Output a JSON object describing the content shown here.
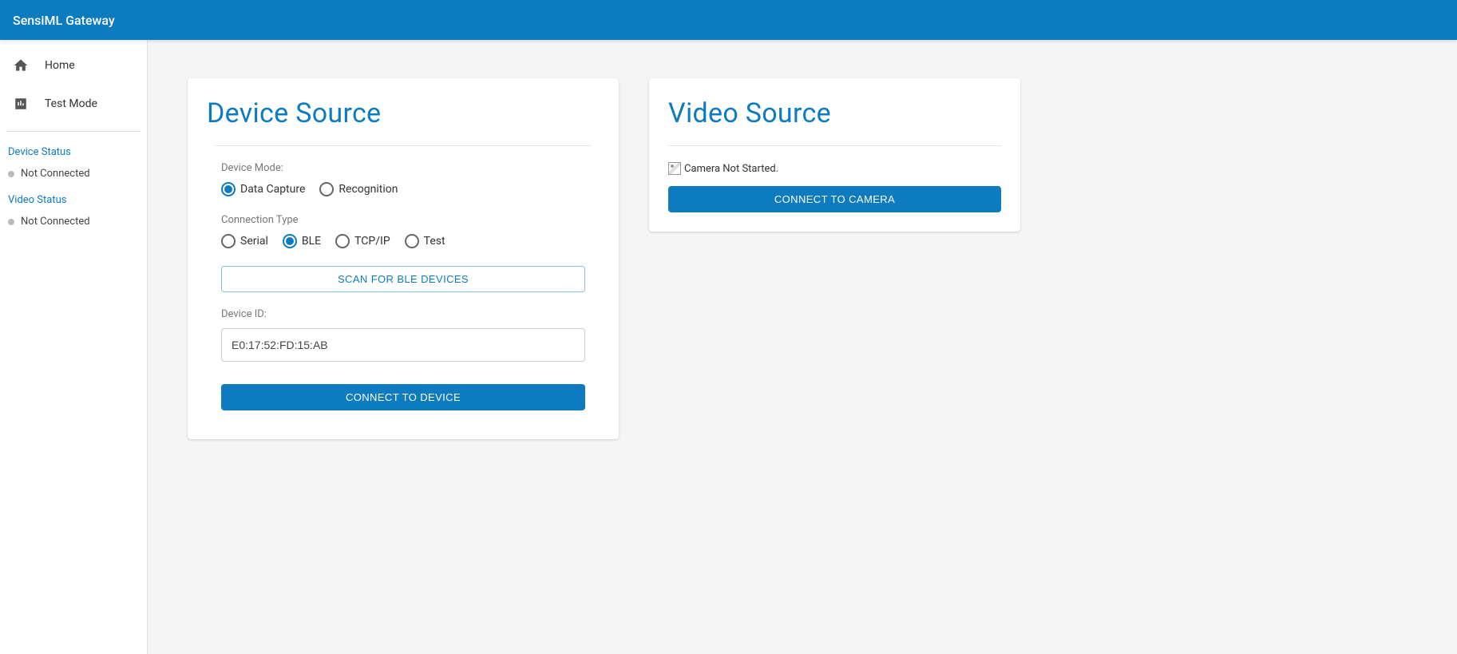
{
  "header": {
    "title": "SensiML Gateway"
  },
  "sidebar": {
    "nav": [
      {
        "label": "Home",
        "icon": "home"
      },
      {
        "label": "Test Mode",
        "icon": "bar-chart"
      }
    ],
    "device_status_title": "Device Status",
    "device_status_value": "Not Connected",
    "video_status_title": "Video Status",
    "video_status_value": "Not Connected"
  },
  "device_card": {
    "title": "Device Source",
    "mode_label": "Device Mode:",
    "mode_options": [
      "Data Capture",
      "Recognition"
    ],
    "mode_selected": "Data Capture",
    "conn_label": "Connection Type",
    "conn_options": [
      "Serial",
      "BLE",
      "TCP/IP",
      "Test"
    ],
    "conn_selected": "BLE",
    "scan_button": "SCAN FOR BLE DEVICES",
    "device_id_label": "Device ID:",
    "device_id_value": "E0:17:52:FD:15:AB",
    "connect_button": "CONNECT TO DEVICE"
  },
  "video_card": {
    "title": "Video Source",
    "camera_status": "Camera Not Started.",
    "connect_button": "CONNECT TO CAMERA"
  }
}
